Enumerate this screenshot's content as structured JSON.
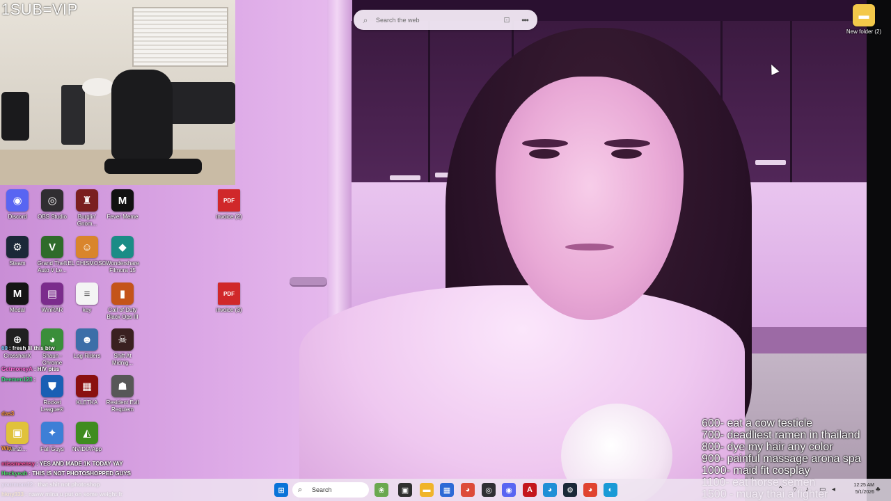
{
  "overlay": {
    "caption": "1SUB=VIP"
  },
  "search_bar": {
    "placeholder": "Search the web",
    "search_icon": "search-icon",
    "visual_search_icon": "camera-lens-icon",
    "more_icon": "more-dots-icon",
    "more_glyph": "•••"
  },
  "desktop": {
    "icons": [
      {
        "label": "Discord",
        "icon": "discord-icon",
        "color": "#5865f2",
        "glyph": "◉"
      },
      {
        "label": "OBS Studio",
        "icon": "obs-icon",
        "color": "#302e31",
        "glyph": "◎"
      },
      {
        "label": "Burglin' Gnom...",
        "icon": "burglin-gnomes-icon",
        "color": "#7a1f1f",
        "glyph": "♜"
      },
      {
        "label": "Fever Meme",
        "icon": "fever-meme-icon",
        "color": "#111111",
        "glyph": "M"
      },
      {
        "label": "Steam",
        "icon": "steam-icon",
        "color": "#1b2838",
        "glyph": "⚙"
      },
      {
        "label": "Grand Theft Auto V Le...",
        "icon": "gta-v-icon",
        "color": "#2f6b2a",
        "glyph": "V"
      },
      {
        "label": "EL CHISMOSO",
        "icon": "el-chismoso-icon",
        "color": "#d9852c",
        "glyph": "☺"
      },
      {
        "label": "Wondershare Filmora 15",
        "icon": "filmora-icon",
        "color": "#1b8c86",
        "glyph": "◆"
      },
      {
        "label": "Medal",
        "icon": "medal-icon",
        "color": "#151515",
        "glyph": "M"
      },
      {
        "label": "WinRAR",
        "icon": "winrar-icon",
        "color": "#7b2c8c",
        "glyph": "▤"
      },
      {
        "label": "key",
        "icon": "text-file-icon",
        "color": "#f4f4f4",
        "glyph": "≡"
      },
      {
        "label": "Call of Duty Black Ops III",
        "icon": "call-of-duty-icon",
        "color": "#c4541a",
        "glyph": "▮"
      },
      {
        "label": "CrosshairX",
        "icon": "crosshairx-icon",
        "color": "#202020",
        "glyph": "⊕"
      },
      {
        "label": "Shaun - Chrome",
        "icon": "chrome-icon",
        "color": "#3a8e3a",
        "glyph": "◕"
      },
      {
        "label": "Log Riders",
        "icon": "log-riders-icon",
        "color": "#3c6ea8",
        "glyph": "☻"
      },
      {
        "label": "Shift At Midnig...",
        "icon": "shift-at-midnight-icon",
        "color": "#3a2020",
        "glyph": "☠"
      },
      {
        "label": "Rocket League®",
        "icon": "rocket-league-icon",
        "color": "#1a5fb4",
        "glyph": "⛊"
      },
      {
        "label": "KLETKA",
        "icon": "kletka-icon",
        "color": "#8a1010",
        "glyph": "▦"
      },
      {
        "label": "Resident Evil Requiem",
        "icon": "resident-evil-icon",
        "color": "#575757",
        "glyph": "☗"
      },
      {
        "label": "WinZi...",
        "icon": "winzip-icon",
        "color": "#e0c23a",
        "glyph": "▣"
      },
      {
        "label": "Fall Guys",
        "icon": "fall-guys-icon",
        "color": "#3d7fd6",
        "glyph": "✦"
      },
      {
        "label": "NVIDIA App",
        "icon": "nvidia-icon",
        "color": "#3f8c1f",
        "glyph": "◭"
      },
      {
        "label": "invoice (2)",
        "icon": "pdf-file-icon",
        "color": "#d0282a",
        "glyph": "PDF"
      },
      {
        "label": "invoice (3)",
        "icon": "pdf-file-icon",
        "color": "#d0282a",
        "glyph": "PDF"
      },
      {
        "label": "New folder (2)",
        "icon": "folder-icon",
        "color": "#f3c84a",
        "glyph": "▬"
      }
    ]
  },
  "chat": [
    {
      "user": "69",
      "text": ": fresh lil this btw",
      "color": "#7ad0ff"
    },
    {
      "user": "GetmoneyA",
      "text": ": HIV piss",
      "color": "#ff6ad5"
    },
    {
      "user": "Deemen123",
      "text": ": ",
      "color": "#3ddc84"
    },
    {
      "user": "das3",
      "text": "",
      "color": "#ff9b3d"
    },
    {
      "user": "Win",
      "text": "",
      "color": "#ff9b3d"
    },
    {
      "user": "missmeensy",
      "text": ": YES AND MADE 1K TODAY YAY",
      "color": "#ff4f9a"
    },
    {
      "user": "Heckyeah",
      "text": ": THIS IS NOT PHOTOSHOPPED GUYS",
      "color": "#4dd66a"
    },
    {
      "user": "yourmom12",
      "text": ": that shit not photoshop",
      "color": "#c7a4ff"
    },
    {
      "user": "hkny333",
      "text": ": naww mina u put on some weight fr",
      "color": "#ffd34d"
    }
  ],
  "goals": [
    "600- eat a cow testicle",
    "700- deadliest ramen in thailand",
    "800- dye my hair any color",
    "900- painful massage arona spa",
    "1000- maid fit cosplay",
    "1100- eat horse semen",
    "1500 - muay thai a fighter"
  ],
  "taskbar": {
    "search_label": "Search",
    "clock_time": "12:25 AM",
    "clock_date": "5/1/2026",
    "apps": [
      {
        "icon": "windows-start-icon",
        "color": "#0a73d8",
        "glyph": "⊞"
      },
      {
        "icon": "widgets-icon",
        "color": "#6aa84f",
        "glyph": "❀"
      },
      {
        "icon": "task-view-icon",
        "color": "#303030",
        "glyph": "▣"
      },
      {
        "icon": "file-explorer-icon",
        "color": "#f0b429",
        "glyph": "▬"
      },
      {
        "icon": "microsoft-store-icon",
        "color": "#2d6ad6",
        "glyph": "▦"
      },
      {
        "icon": "chrome-icon",
        "color": "#dd4b39",
        "glyph": "◕"
      },
      {
        "icon": "obs-icon",
        "color": "#2f2f33",
        "glyph": "◎"
      },
      {
        "icon": "discord-icon",
        "color": "#5865f2",
        "glyph": "◉"
      },
      {
        "icon": "adobe-icon",
        "color": "#c4161c",
        "glyph": "A"
      },
      {
        "icon": "chrome-profile-icon",
        "color": "#1f8fd6",
        "glyph": "◕"
      },
      {
        "icon": "steam-icon",
        "color": "#1b2838",
        "glyph": "⚙"
      },
      {
        "icon": "chrome-icon",
        "color": "#e0432f",
        "glyph": "◕"
      },
      {
        "icon": "edge-icon",
        "color": "#1a9ad6",
        "glyph": "◐"
      }
    ],
    "tray": [
      {
        "icon": "chevron-up-icon",
        "glyph": "⌃"
      },
      {
        "icon": "network-icon",
        "glyph": "⌔"
      },
      {
        "icon": "microphone-icon",
        "glyph": "♪"
      },
      {
        "icon": "display-icon",
        "glyph": "▭"
      },
      {
        "icon": "volume-icon",
        "glyph": "◂"
      },
      {
        "icon": "notification-bell-icon",
        "glyph": "♣"
      }
    ]
  }
}
